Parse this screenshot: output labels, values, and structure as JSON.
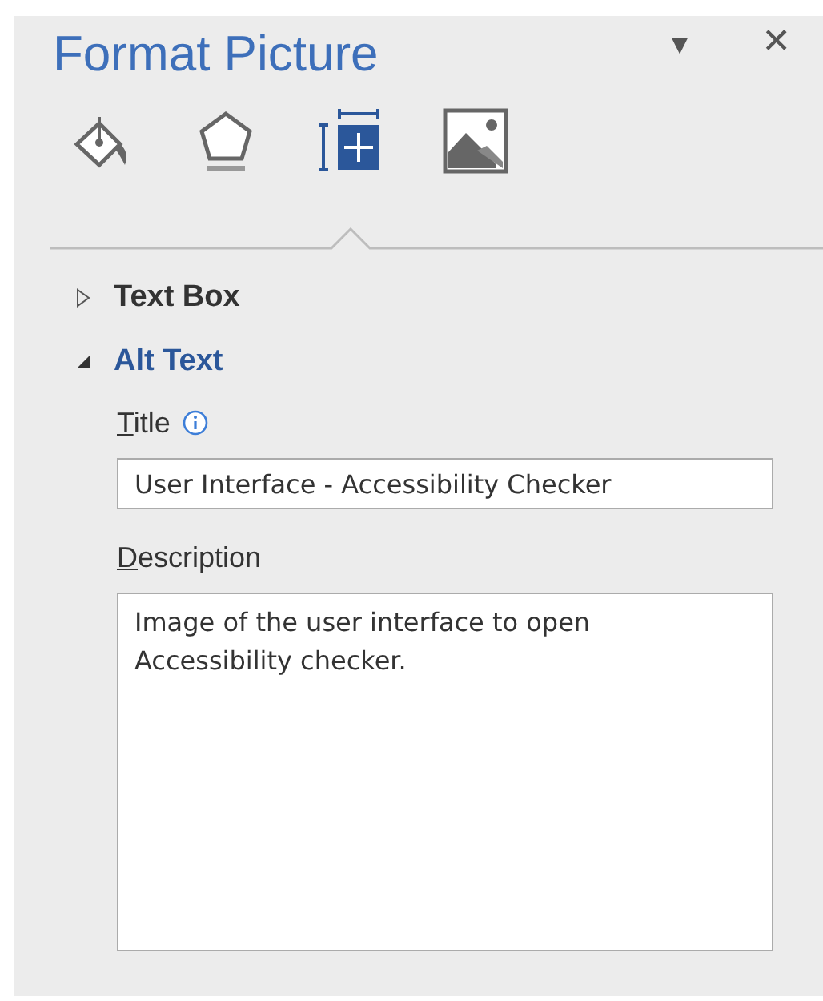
{
  "pane": {
    "title": "Format Picture",
    "menu_glyph": "▾",
    "close_glyph": "✕"
  },
  "tabs": [
    {
      "kind": "fill",
      "selected": false
    },
    {
      "kind": "effects",
      "selected": false
    },
    {
      "kind": "layout",
      "selected": true
    },
    {
      "kind": "picture",
      "selected": false
    }
  ],
  "sections": [
    {
      "label": "Text Box",
      "expanded": false
    },
    {
      "label": "Alt Text",
      "expanded": true
    }
  ],
  "fields": [
    {
      "kind": "input",
      "label": "Title",
      "info": true,
      "value": "User Interface - Accessibility Checker"
    },
    {
      "kind": "textarea",
      "label": "Description",
      "info": false,
      "value": "Image of the user interface to open Accessibility checker."
    }
  ]
}
